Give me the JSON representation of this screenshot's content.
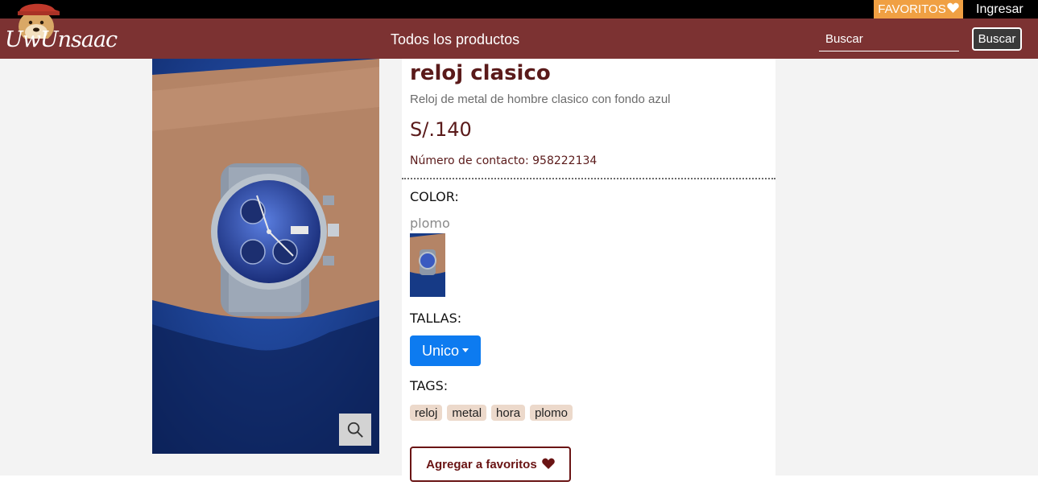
{
  "topbar": {
    "favorites_label": "FAVORITOS",
    "favorites_icon": "heart-icon",
    "login_label": "Ingresar"
  },
  "navbar": {
    "logo_text": "UwUnsaac",
    "title": "Todos los productos",
    "search_placeholder": "Buscar",
    "search_button": "Buscar"
  },
  "product": {
    "title": "reloj clasico",
    "description": "Reloj de metal de hombre clasico con fondo azul",
    "price": "S/.140",
    "contact": "Número de contacto: 958222134",
    "color_label": "COLOR:",
    "color_name": "plomo",
    "sizes_label": "TALLAS:",
    "size_selected": "Unico",
    "tags_label": "TAGS:",
    "tags": [
      "reloj",
      "metal",
      "hora",
      "plomo"
    ],
    "favorite_button": "Agregar a favoritos"
  },
  "colors": {
    "navbar": "#7c3232",
    "favorites_badge": "#f0a043",
    "primary_button": "#0d7bf0",
    "accent_text": "#5a1a1a"
  }
}
